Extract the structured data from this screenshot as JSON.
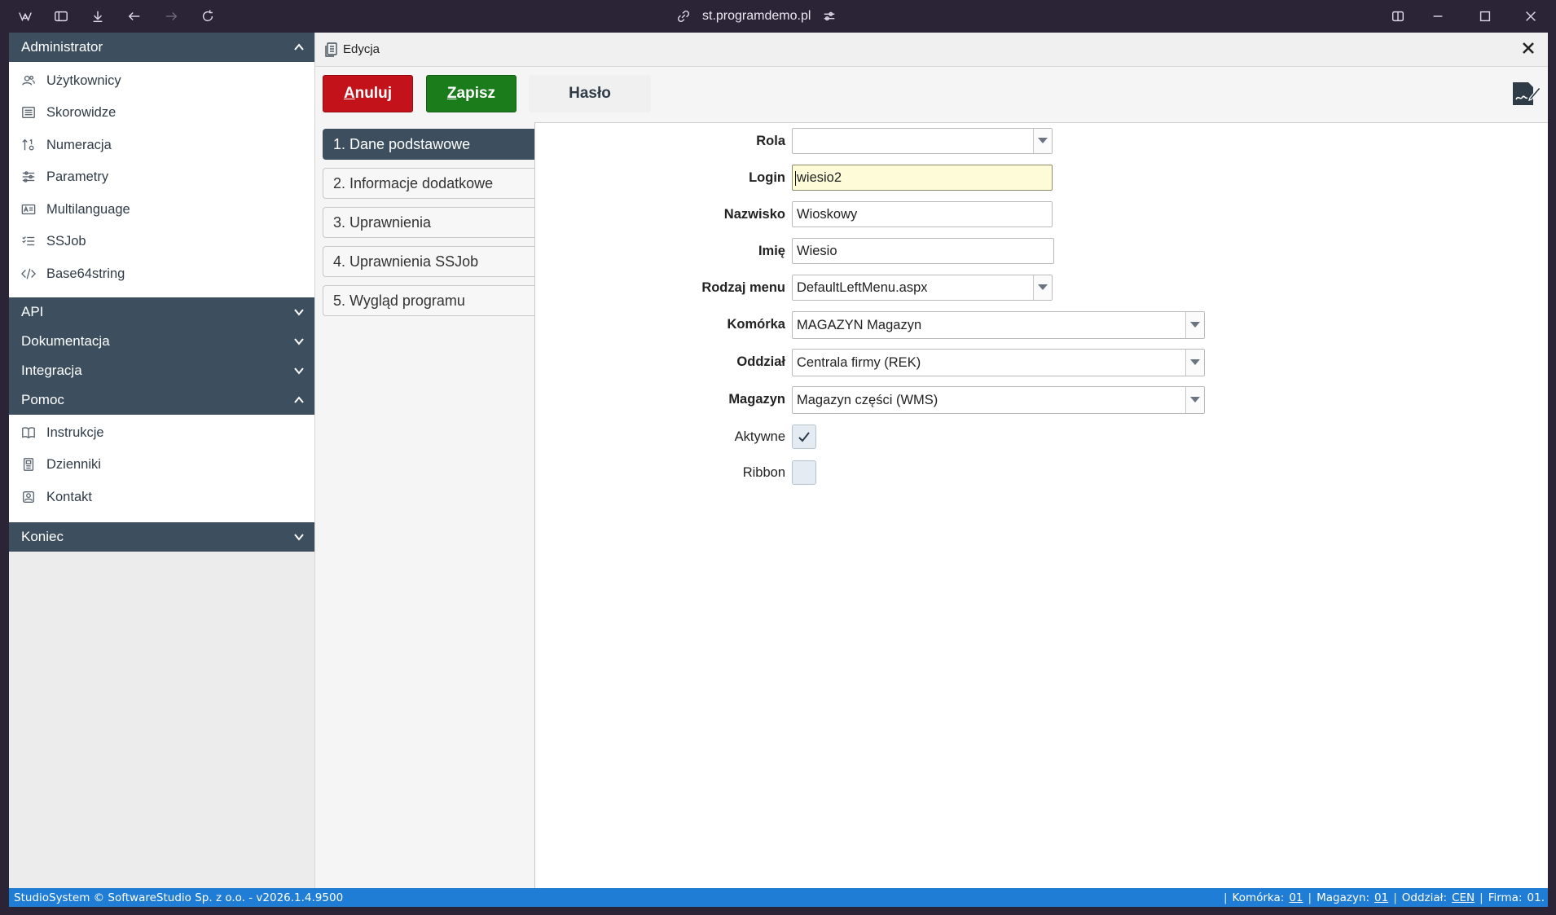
{
  "browser": {
    "url": "st.programdemo.pl"
  },
  "sidebar": {
    "sections": [
      {
        "label": "Administrator",
        "expanded": true,
        "items": [
          "Użytkownicy",
          "Skorowidze",
          "Numeracja",
          "Parametry",
          "Multilanguage",
          "SSJob",
          "Base64string"
        ]
      },
      {
        "label": "API",
        "expanded": false
      },
      {
        "label": "Dokumentacja",
        "expanded": false
      },
      {
        "label": "Integracja",
        "expanded": false
      },
      {
        "label": "Pomoc",
        "expanded": true,
        "items": [
          "Instrukcje",
          "Dzienniki",
          "Kontakt"
        ]
      },
      {
        "label": "Koniec",
        "expanded": false
      }
    ]
  },
  "panel": {
    "title": "Edycja",
    "buttons": {
      "cancel_first": "A",
      "cancel_rest": "nuluj",
      "save_first": "Z",
      "save_rest": "apisz",
      "password": "Hasło"
    },
    "tabs": [
      "1. Dane podstawowe",
      "2. Informacje dodatkowe",
      "3. Uprawnienia",
      "4. Uprawnienia SSJob",
      "5. Wygląd programu"
    ],
    "active_tab": 0
  },
  "form": {
    "rola": {
      "label": "Rola",
      "value": ""
    },
    "login": {
      "label": "Login",
      "value": "wiesio2"
    },
    "nazwisko": {
      "label": "Nazwisko",
      "value": "Wioskowy"
    },
    "imie": {
      "label": "Imię",
      "value": "Wiesio"
    },
    "rodzaj_menu": {
      "label": "Rodzaj menu",
      "value": "DefaultLeftMenu.aspx"
    },
    "komorka": {
      "label": "Komórka",
      "value": "MAGAZYN Magazyn"
    },
    "oddzial": {
      "label": "Oddział",
      "value": "Centrala firmy (REK)"
    },
    "magazyn": {
      "label": "Magazyn",
      "value": "Magazyn części (WMS)"
    },
    "aktywne": {
      "label": "Aktywne",
      "checked": true
    },
    "ribbon": {
      "label": "Ribbon",
      "checked": false
    }
  },
  "status": {
    "left": "StudioSystem © SoftwareStudio Sp. z o.o. - v2026.1.4.9500",
    "komorka_label": "Komórka:",
    "komorka_value": "01",
    "magazyn_label": "Magazyn:",
    "magazyn_value": "01",
    "oddzial_label": "Oddział:",
    "oddzial_value": "CEN",
    "firma_label": "Firma:",
    "firma_value": "01."
  },
  "colors": {
    "section_header": "#3d4f5f",
    "cancel": "#c4121b",
    "save": "#1b7c1b",
    "statusbar": "#1f7dd6",
    "focus_field": "#fdfbd8"
  }
}
